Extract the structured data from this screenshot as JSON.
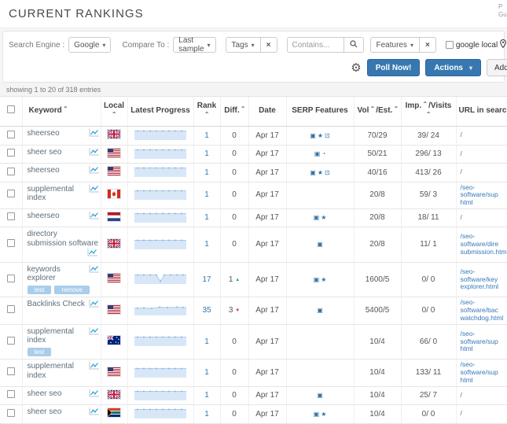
{
  "header": {
    "title": "CURRENT RANKINGS",
    "corner_line1": "P",
    "corner_line2": "Gu"
  },
  "filters": {
    "search_engine_label": "Search Engine :",
    "search_engine_value": "Google",
    "compare_to_label": "Compare To :",
    "compare_to_value": "Last sample",
    "tags_button": "Tags",
    "contains_placeholder": "Contains...",
    "features_button": "Features",
    "google_local_label": "google local",
    "google_local_checked": false
  },
  "toolbar": {
    "poll_now": "Poll Now!",
    "actions": "Actions",
    "add_keyword": "Add K"
  },
  "icons": {
    "caret": "▾",
    "close": "×",
    "gear": "⚙",
    "up_arrow": "▲",
    "down_arrow": "▼"
  },
  "colors": {
    "accent_blue": "#3878b0",
    "link_blue": "#3779b8",
    "chip_blue": "#a9cdea",
    "green_up": "#3d9960",
    "red_down": "#c9302c"
  },
  "table": {
    "showing": "showing 1 to 20 of 318 entries",
    "columns": [
      "Keyword ˆ",
      "Local ˆ",
      "Latest Progress",
      "Rank ˆ",
      "Diff. ˆ",
      "Date",
      "SERP Features",
      "Vol ˆ /Est. ˆ",
      "Imp. ˆ /Visits ˆ",
      "URL in search re"
    ],
    "serp_glyphs": {
      "image-pack-icon": "▣",
      "review-star-icon": "★",
      "clock-icon": "◔",
      "shopping-tag-icon": "⊡"
    },
    "rows": [
      {
        "keyword": "sheerseo",
        "tags": [],
        "flag": "gb",
        "spark": "flat",
        "rank": "1",
        "diff": "0",
        "dir": "",
        "date": "Apr 17",
        "serp": [
          "image-pack-icon",
          "review-star-icon",
          "shopping-tag-icon"
        ],
        "vol": "70/29",
        "imp": "39/ 24",
        "url": [
          "/"
        ]
      },
      {
        "keyword": "sheer seo",
        "tags": [],
        "flag": "us",
        "spark": "flat",
        "rank": "1",
        "diff": "0",
        "dir": "",
        "date": "Apr 17",
        "serp": [
          "image-pack-icon",
          "clock-icon"
        ],
        "vol": "50/21",
        "imp": "296/ 13",
        "url": [
          "/"
        ]
      },
      {
        "keyword": "sheerseo",
        "tags": [],
        "flag": "us",
        "spark": "flat",
        "rank": "1",
        "diff": "0",
        "dir": "",
        "date": "Apr 17",
        "serp": [
          "image-pack-icon",
          "review-star-icon",
          "shopping-tag-icon"
        ],
        "vol": "40/16",
        "imp": "413/ 26",
        "url": [
          "/"
        ]
      },
      {
        "keyword": "supplemental index",
        "tags": [],
        "flag": "ca",
        "spark": "flat",
        "rank": "1",
        "diff": "0",
        "dir": "",
        "date": "Apr 17",
        "serp": [],
        "vol": "20/8",
        "imp": "59/ 3",
        "url": [
          "/seo-software/sup",
          "html"
        ]
      },
      {
        "keyword": "sheerseo",
        "tags": [],
        "flag": "nl",
        "spark": "flat",
        "rank": "1",
        "diff": "0",
        "dir": "",
        "date": "Apr 17",
        "serp": [
          "image-pack-icon",
          "review-star-icon"
        ],
        "vol": "20/8",
        "imp": "18/ 11",
        "url": [
          "/"
        ]
      },
      {
        "keyword": "directory submission software",
        "tags": [],
        "flag": "gb",
        "spark": "flat",
        "rank": "1",
        "diff": "0",
        "dir": "",
        "date": "Apr 17",
        "serp": [
          "image-pack-icon"
        ],
        "vol": "20/8",
        "imp": "11/ 1",
        "url": [
          "/seo-software/dire",
          "submission.html"
        ],
        "icon_below": true
      },
      {
        "keyword": "keywords explorer",
        "tags": [
          "test",
          "remove"
        ],
        "flag": "us",
        "spark": "dip",
        "rank": "17",
        "diff": "1",
        "dir": "up",
        "date": "Apr 17",
        "serp": [
          "image-pack-icon",
          "review-star-icon"
        ],
        "vol": "1600/5",
        "imp": "0/ 0",
        "url": [
          "/seo-software/key",
          "explorer.html"
        ]
      },
      {
        "keyword": "Backlinks Check",
        "tags": [],
        "flag": "us",
        "spark": "bump",
        "rank": "35",
        "diff": "3",
        "dir": "down",
        "date": "Apr 17",
        "serp": [
          "image-pack-icon"
        ],
        "vol": "5400/5",
        "imp": "0/ 0",
        "url": [
          "/seo-software/bac",
          "watchdog.html"
        ]
      },
      {
        "keyword": "supplemental index",
        "tags": [
          "test"
        ],
        "flag": "au",
        "spark": "flat",
        "rank": "1",
        "diff": "0",
        "dir": "",
        "date": "Apr 17",
        "serp": [],
        "vol": "10/4",
        "imp": "66/ 0",
        "url": [
          "/seo-software/sup",
          "html"
        ]
      },
      {
        "keyword": "supplemental index",
        "tags": [],
        "flag": "us",
        "spark": "flat",
        "rank": "1",
        "diff": "0",
        "dir": "",
        "date": "Apr 17",
        "serp": [],
        "vol": "10/4",
        "imp": "133/ 11",
        "url": [
          "/seo-software/sup",
          "html"
        ]
      },
      {
        "keyword": "sheer seo",
        "tags": [],
        "flag": "gb",
        "spark": "flat",
        "rank": "1",
        "diff": "0",
        "dir": "",
        "date": "Apr 17",
        "serp": [
          "image-pack-icon"
        ],
        "vol": "10/4",
        "imp": "25/ 7",
        "url": [
          "/"
        ]
      },
      {
        "keyword": "sheer seo",
        "tags": [],
        "flag": "za",
        "spark": "flat",
        "rank": "1",
        "diff": "0",
        "dir": "",
        "date": "Apr 17",
        "serp": [
          "image-pack-icon",
          "review-star-icon"
        ],
        "vol": "10/4",
        "imp": "0/ 0",
        "url": [
          "/"
        ]
      }
    ]
  }
}
